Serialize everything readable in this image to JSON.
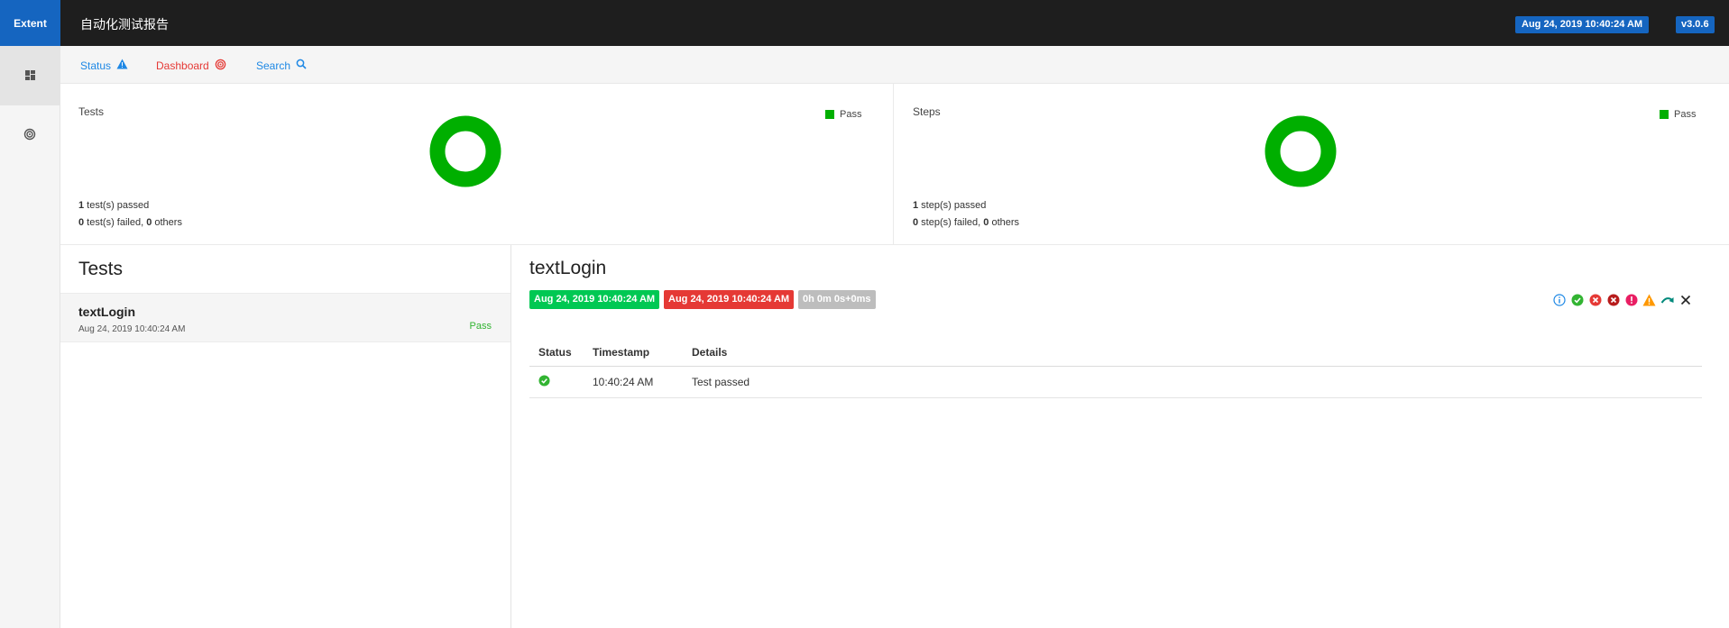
{
  "header": {
    "brand": "Extent",
    "report_name": "自动化测试报告",
    "date_badge": "Aug 24, 2019 10:40:24 AM",
    "version_badge": "v3.0.6"
  },
  "sidenav": {
    "items": [
      {
        "icon": "dashboard-grid-icon",
        "active": true
      },
      {
        "icon": "radar-icon",
        "active": false
      }
    ]
  },
  "subnav": {
    "links": [
      {
        "label": "Status",
        "icon": "warning-triangle-icon",
        "color": "#1e88e5"
      },
      {
        "label": "Dashboard",
        "icon": "radar-icon",
        "color": "#e53935"
      },
      {
        "label": "Search",
        "icon": "search-icon",
        "color": "#1e88e5"
      }
    ]
  },
  "charts": {
    "tests": {
      "title": "Tests",
      "legend": "Pass",
      "passed_count": "1",
      "passed_text": " test(s) passed",
      "failed_count": "0",
      "failed_text": " test(s) failed, ",
      "others_count": "0",
      "others_text": " others"
    },
    "steps": {
      "title": "Steps",
      "legend": "Pass",
      "passed_count": "1",
      "passed_text": " step(s) passed",
      "failed_count": "0",
      "failed_text": " step(s) failed, ",
      "others_count": "0",
      "others_text": " others"
    }
  },
  "colors": {
    "pass": "#00af00",
    "accent": "#1565c0",
    "fail": "#e53935"
  },
  "tests_list": {
    "heading": "Tests",
    "items": [
      {
        "name": "textLogin",
        "time": "Aug 24, 2019 10:40:24 AM",
        "status": "Pass"
      }
    ]
  },
  "detail": {
    "title": "textLogin",
    "start": "Aug 24, 2019 10:40:24 AM",
    "end": "Aug 24, 2019 10:40:24 AM",
    "duration": "0h 0m 0s+0ms",
    "filters": [
      "info-icon",
      "pass-icon",
      "fail-icon",
      "fatal-icon",
      "error-icon",
      "warning-icon",
      "skip-icon",
      "clear-icon"
    ],
    "columns": [
      "Status",
      "Timestamp",
      "Details"
    ],
    "rows": [
      {
        "status_icon": "pass-check-icon",
        "timestamp": "10:40:24 AM",
        "details": "Test passed"
      }
    ]
  }
}
